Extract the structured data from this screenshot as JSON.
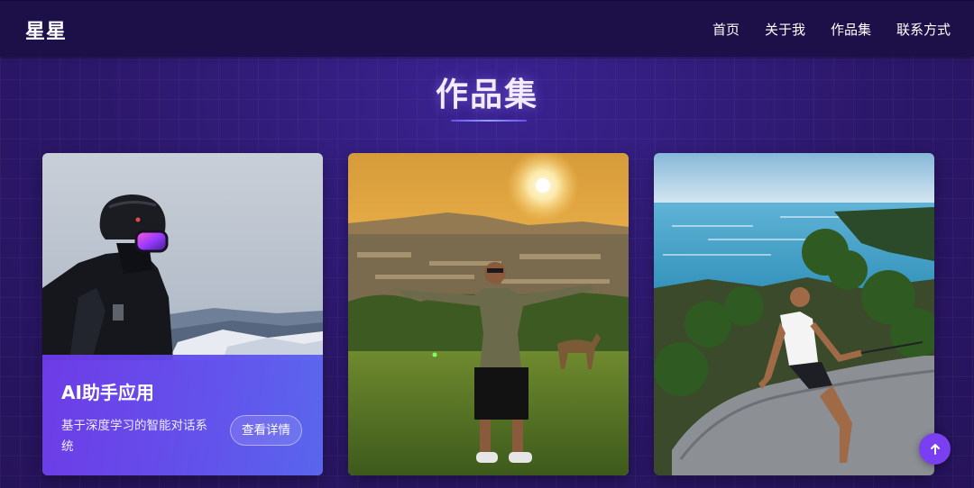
{
  "header": {
    "logo": "星星",
    "nav": [
      "首页",
      "关于我",
      "作品集",
      "联系方式"
    ]
  },
  "portfolio": {
    "title": "作品集",
    "cards": [
      {
        "image": "snowboarder-with-helmet-photo",
        "overlay": {
          "title": "AI助手应用",
          "description": "基于深度学习的智能对话系统",
          "button": "查看详情"
        }
      },
      {
        "image": "man-arms-outstretched-at-sunset-photo"
      },
      {
        "image": "man-sitting-on-rocks-by-sea-photo"
      }
    ]
  },
  "back_to_top_icon": "arrow-up-icon",
  "colors": {
    "background": "#2b1766",
    "nav_background": "#1d0f48",
    "accent": "#7a3ff0",
    "overlay": "#6c38e8"
  }
}
